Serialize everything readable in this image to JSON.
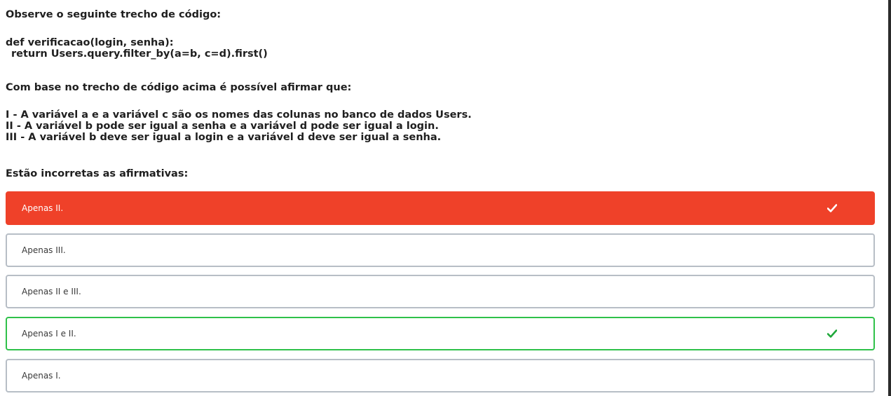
{
  "question": {
    "intro": "Observe o seguinte trecho de código:",
    "code_line1": "def verificacao(login, senha):",
    "code_line2": "return Users.query.filter_by(a=b, c=d).first()",
    "base": "Com base no trecho de código acima é possível afirmar que:",
    "statements": [
      "I - A variável a e a variável c são os nomes das colunas no banco de dados Users.",
      "II - A variável b pode ser igual a senha e a variável d pode ser igual a login.",
      "III - A variável b deve ser igual a login e a variável d deve ser igual a senha."
    ],
    "ask": "Estão incorretas as afirmativas:"
  },
  "options": [
    {
      "label": "Apenas II.",
      "state": "selected-wrong",
      "icon": "check-icon"
    },
    {
      "label": "Apenas III.",
      "state": "default"
    },
    {
      "label": "Apenas II e III.",
      "state": "default"
    },
    {
      "label": "Apenas I e II.",
      "state": "correct",
      "icon": "check-icon"
    },
    {
      "label": "Apenas I.",
      "state": "default"
    }
  ],
  "colors": {
    "wrong": "#ef4129",
    "correct": "#2fc14a",
    "border": "#b7bec6",
    "check_on_wrong": "#ffffff",
    "check_on_correct": "#1fa83a"
  }
}
